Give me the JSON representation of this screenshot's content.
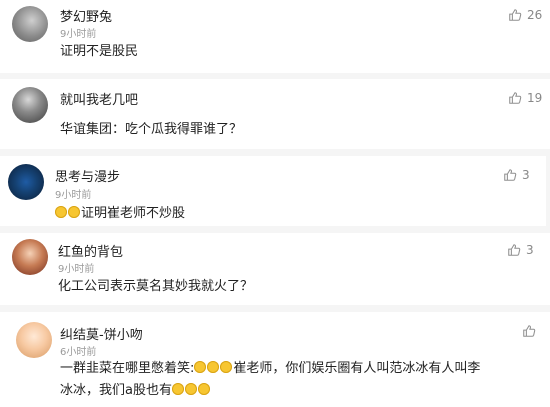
{
  "comments": [
    {
      "user": "梦幻野兔",
      "time": "9小时前",
      "text": "证明不是股民",
      "likes": "26"
    },
    {
      "user": "就叫我老几吧",
      "time": "9小时前",
      "text": "华谊集团：吃个瓜我得罪谁了？",
      "likes": "19"
    },
    {
      "user": "思考与漫步",
      "time": "9小时前",
      "text": "证明崔老师不炒股",
      "likes": "3"
    },
    {
      "user": "红鱼的背包",
      "time": "9小时前",
      "text": "化工公司表示莫名其妙我就火了？",
      "likes": "3"
    },
    {
      "user": "纠结莫-饼小吻",
      "time": "6小时前",
      "text_line1": "一群韭菜在哪里憋着笑:",
      "text_line1b": "崔老师，你们娱乐圈有人叫范冰冰有人叫李",
      "text_line2": "冰冰，我们a股也有",
      "likes": ""
    }
  ],
  "icons": {
    "like": "thumbs-up-icon",
    "emoji": "laughing-emoji-icon"
  }
}
